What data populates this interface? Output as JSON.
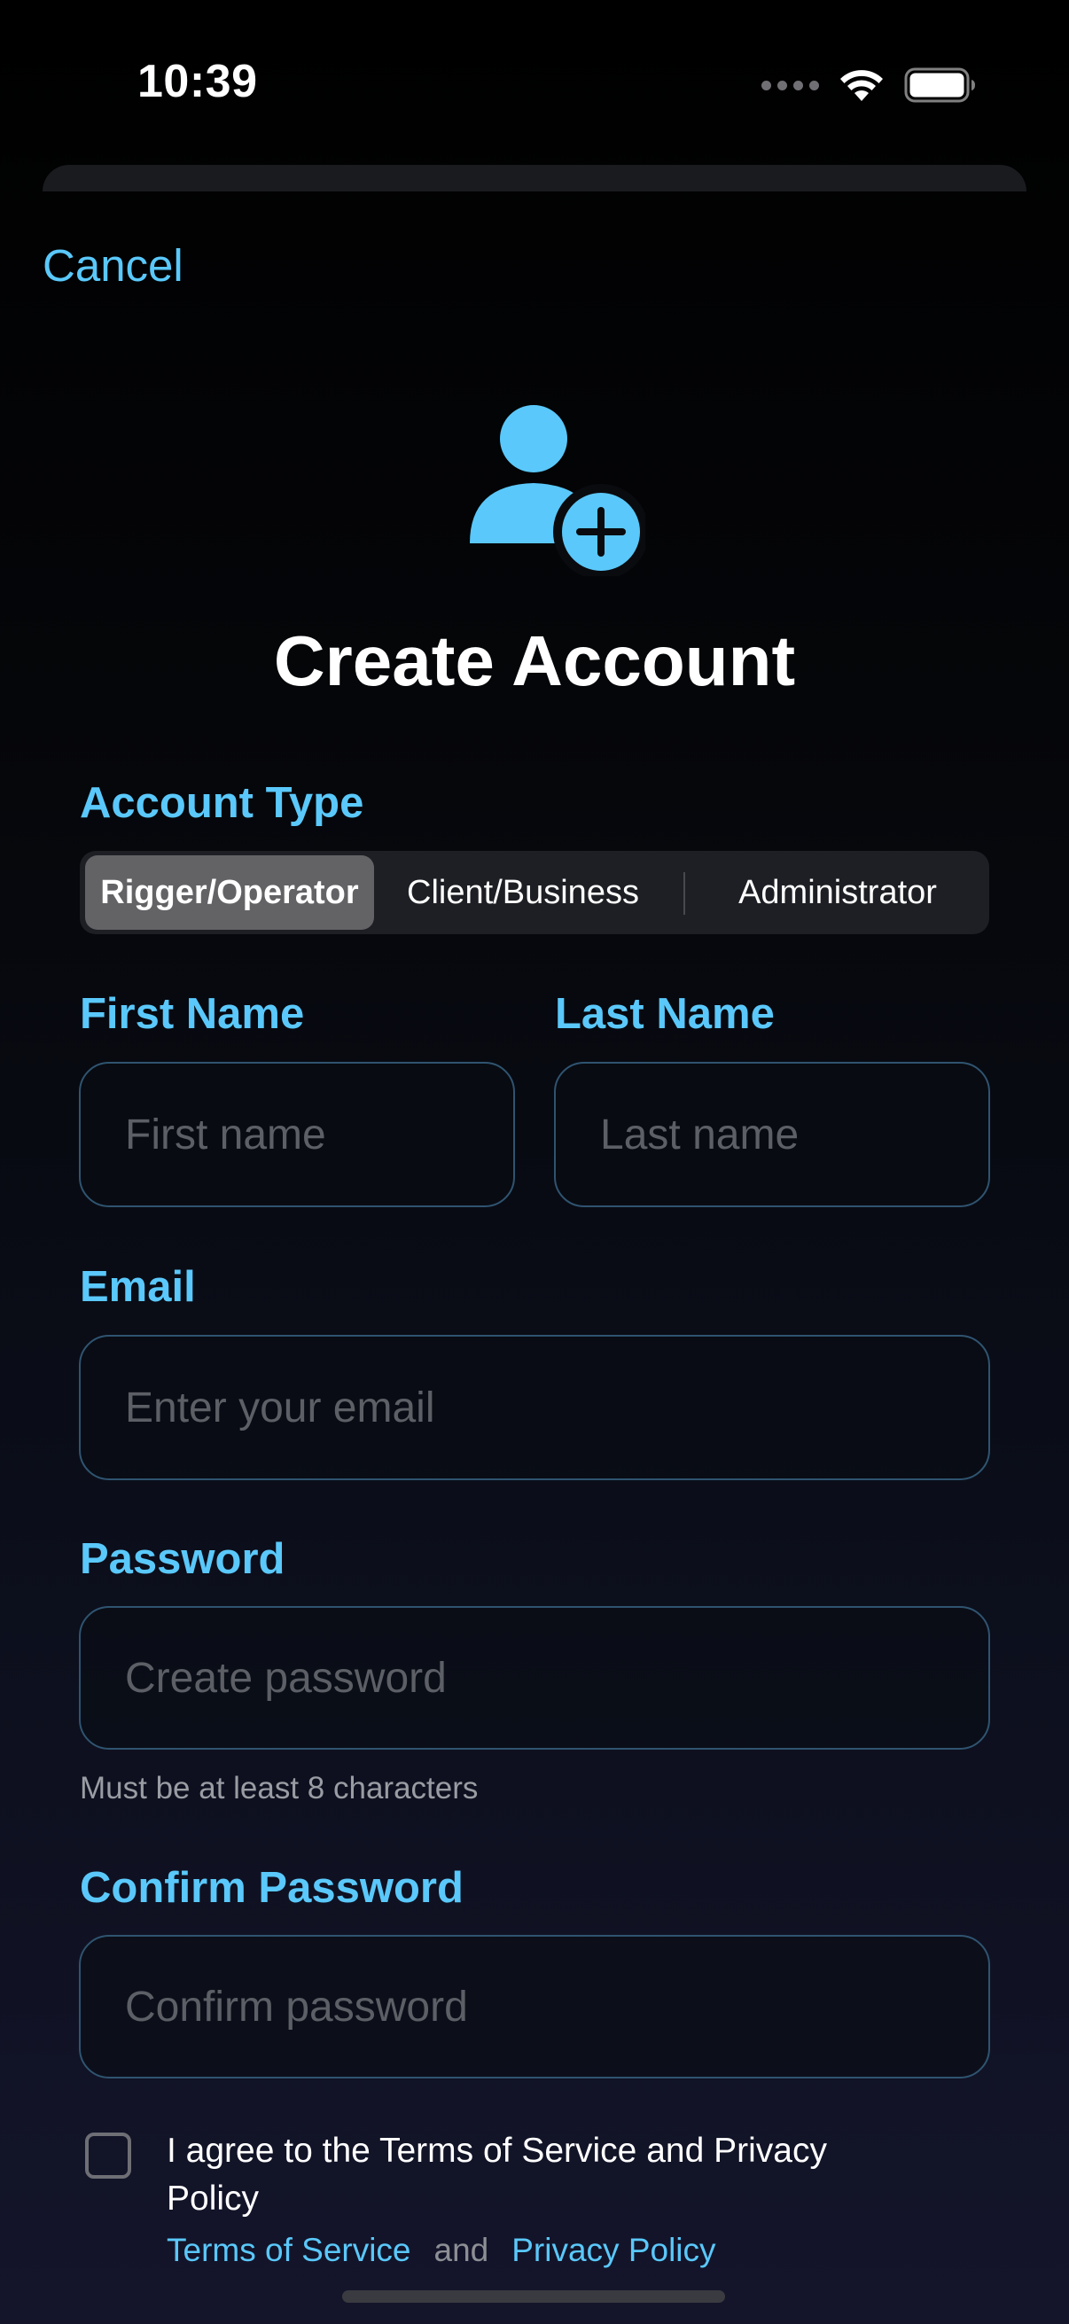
{
  "status_bar": {
    "time": "10:39",
    "signal_icon": "signal-dots-icon",
    "wifi_icon": "wifi-icon",
    "battery_icon": "battery-icon"
  },
  "nav": {
    "cancel_label": "Cancel"
  },
  "header": {
    "icon": "person-add-icon",
    "title": "Create Account"
  },
  "account_type": {
    "label": "Account Type",
    "options": [
      "Rigger/Operator",
      "Client/Business",
      "Administrator"
    ],
    "selected": "Rigger/Operator"
  },
  "form": {
    "first_name": {
      "label": "First Name",
      "placeholder": "First name",
      "value": ""
    },
    "last_name": {
      "label": "Last Name",
      "placeholder": "Last name",
      "value": ""
    },
    "email": {
      "label": "Email",
      "placeholder": "Enter your email",
      "value": ""
    },
    "password": {
      "label": "Password",
      "placeholder": "Create password",
      "value": "",
      "hint": "Must be at least 8 characters"
    },
    "confirm_password": {
      "label": "Confirm Password",
      "placeholder": "Confirm password",
      "value": ""
    }
  },
  "terms": {
    "checked": false,
    "text": "I agree to the Terms of Service and Privacy Policy",
    "tos_link": "Terms of Service",
    "and": "and",
    "privacy_link": "Privacy Policy"
  },
  "colors": {
    "accent": "#5ac8fa",
    "background": "#000000",
    "field_border": "#2f5470",
    "segment_selected": "#636366"
  }
}
